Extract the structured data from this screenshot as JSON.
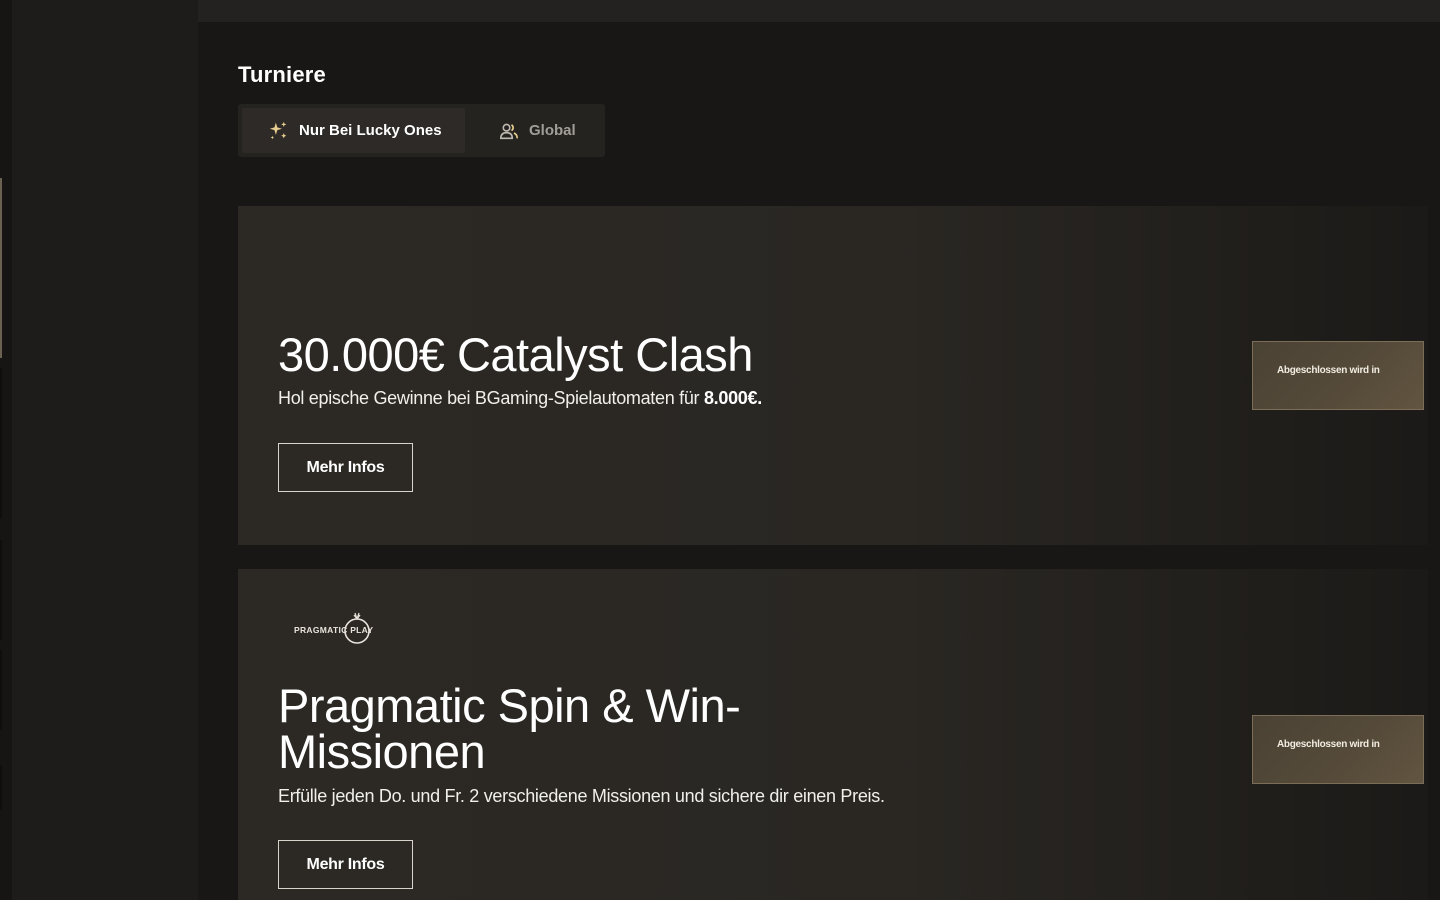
{
  "page": {
    "title": "Turniere"
  },
  "tabs": [
    {
      "label": "Nur Bei Lucky Ones",
      "icon": "sparkles-icon",
      "active": true
    },
    {
      "label": "Global",
      "icon": "users-icon",
      "active": false
    }
  ],
  "tournaments": [
    {
      "title": "30.000€ Catalyst Clash",
      "description_text": "Hol epische Gewinne bei BGaming-Spielautomaten für ",
      "description_bold": "8.000€.",
      "button_label": "Mehr Infos",
      "countdown_label": "Abgeschlossen wird in"
    },
    {
      "provider_logo": "PRAGMATIC PLAY",
      "title": "Pragmatic Spin & Win-Missionen",
      "description_text": "Erfülle jeden Do. und Fr. 2 verschiedene Missionen und sichere dir einen Preis.",
      "button_label": "Mehr Infos",
      "countdown_label": "Abgeschlossen wird in"
    }
  ],
  "colors": {
    "background": "#191715",
    "card": "#2c2925",
    "countdown_bg": "#564b3a",
    "text": "#ffffff",
    "muted_text": "#a19d97"
  }
}
